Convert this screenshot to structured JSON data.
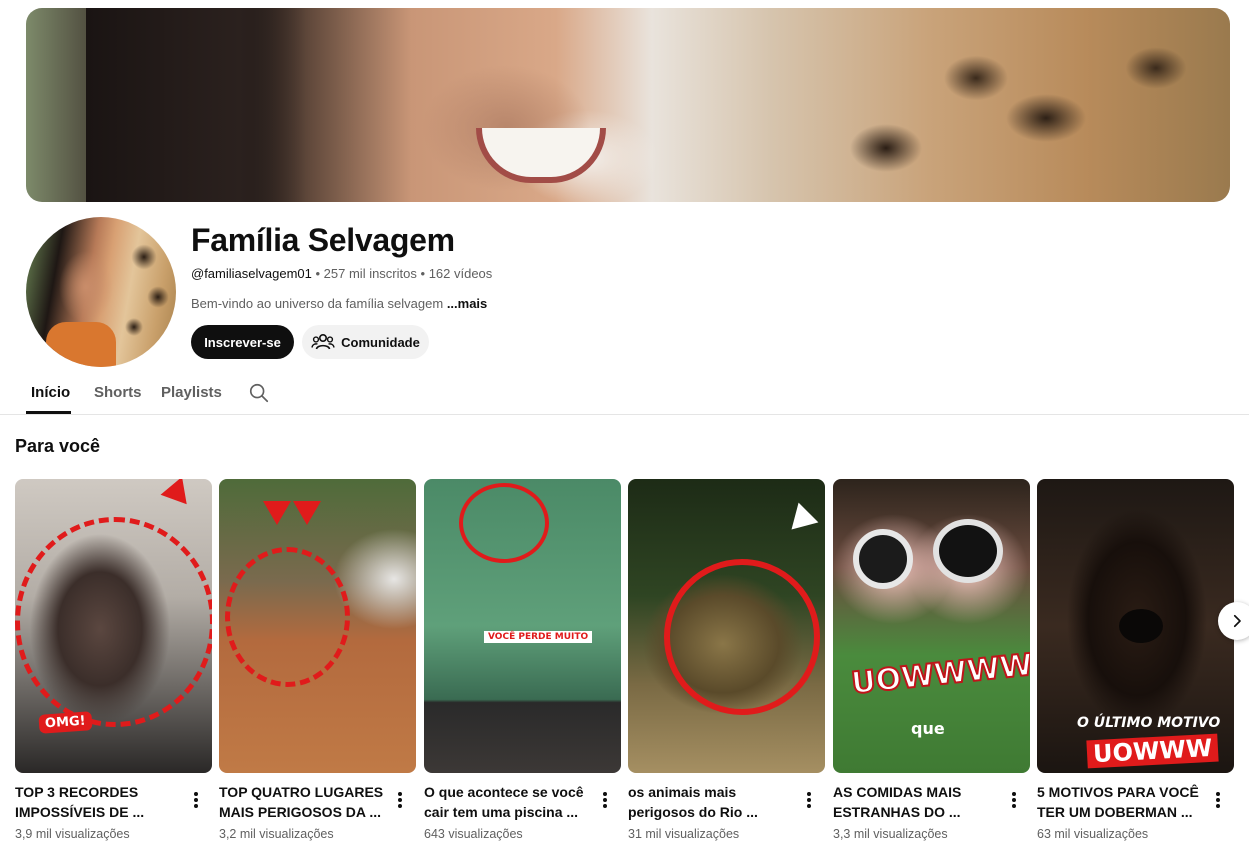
{
  "channel": {
    "name": "Família Selvagem",
    "handle": "@familiaselvagem01",
    "subscribers": "257 mil inscritos",
    "videos": "162 vídeos",
    "separator": "•",
    "description": "Bem-vindo ao universo da família selvagem",
    "more_label": "...mais"
  },
  "buttons": {
    "subscribe": "Inscrever-se",
    "community": "Comunidade"
  },
  "tabs": [
    {
      "label": "Início",
      "active": true
    },
    {
      "label": "Shorts",
      "active": false
    },
    {
      "label": "Playlists",
      "active": false
    }
  ],
  "section": {
    "title": "Para você"
  },
  "videos": [
    {
      "title": "TOP 3 RECORDES IMPOSSÍVEIS DE ...",
      "views": "3,9 mil visualizações",
      "overlay": "OMG!"
    },
    {
      "title": "TOP QUATRO LUGARES MAIS PERIGOSOS DA ...",
      "views": "3,2 mil visualizações",
      "overlay": ""
    },
    {
      "title": "O que acontece se você cair tem uma piscina ...",
      "views": "643 visualizações",
      "overlay": "VOCÊ PERDE MUITO"
    },
    {
      "title": "os animais mais perigosos do Rio ...",
      "views": "31 mil visualizações",
      "overlay": ""
    },
    {
      "title": "AS COMIDAS MAIS ESTRANHAS DO ...",
      "views": "3,3 mil visualizações",
      "overlay": "UOWWWW",
      "overlay2": "que"
    },
    {
      "title": "5 MOTIVOS PARA VOCÊ TER UM DOBERMAN ...",
      "views": "63 mil visualizações",
      "overlay": "O ÚLTIMO MOTIVO",
      "overlay2": "UOWWW"
    }
  ],
  "icons": {
    "community": "people-icon",
    "search": "search-icon",
    "more": "more-vert-icon",
    "next": "chevron-right-icon"
  },
  "colors": {
    "primary_text": "#0f0f0f",
    "secondary_text": "#606060",
    "subscribe_bg": "#0f0f0f",
    "chip_bg": "#f2f2f2",
    "accent_red": "#e01b1b"
  }
}
